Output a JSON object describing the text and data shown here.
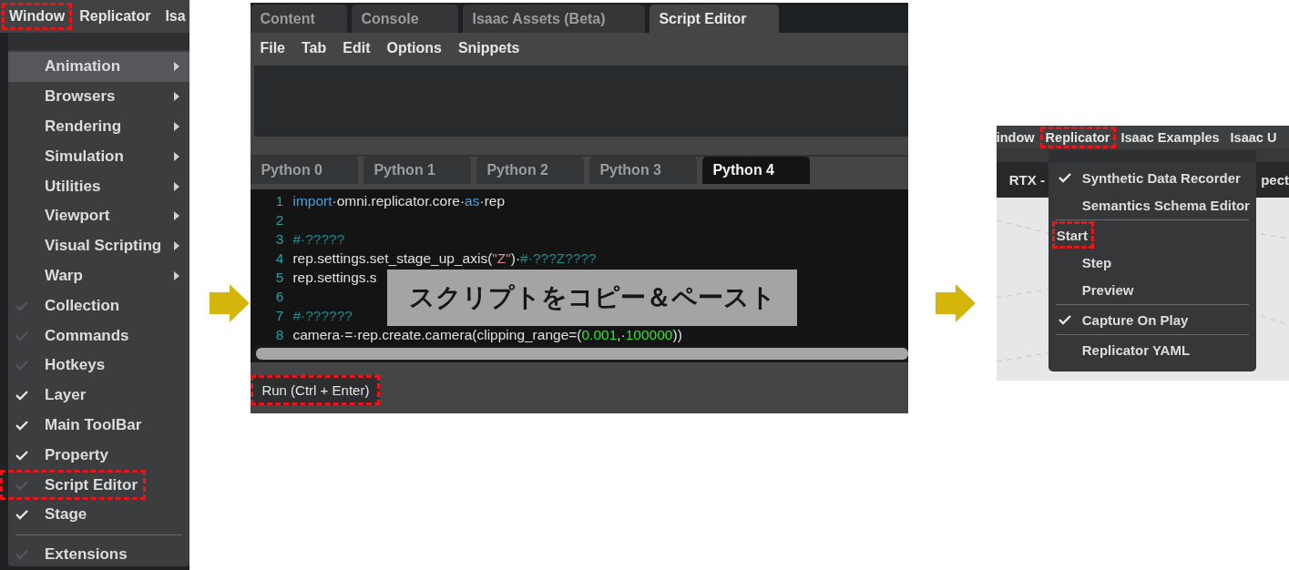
{
  "window_menu": {
    "menubar": [
      {
        "label": "Window",
        "highlighted": true
      },
      {
        "label": "Replicator",
        "highlighted": false
      },
      {
        "label": "Isa",
        "highlighted": false
      }
    ],
    "items": [
      {
        "kind": "submenu",
        "label": "Animation",
        "hovered": true,
        "highlighted": false
      },
      {
        "kind": "submenu",
        "label": "Browsers",
        "hovered": false,
        "highlighted": false
      },
      {
        "kind": "submenu",
        "label": "Rendering",
        "hovered": false,
        "highlighted": false
      },
      {
        "kind": "submenu",
        "label": "Simulation",
        "hovered": false,
        "highlighted": false
      },
      {
        "kind": "submenu",
        "label": "Utilities",
        "hovered": false,
        "highlighted": false
      },
      {
        "kind": "submenu",
        "label": "Viewport",
        "hovered": false,
        "highlighted": false
      },
      {
        "kind": "submenu",
        "label": "Visual Scripting",
        "hovered": false,
        "highlighted": false
      },
      {
        "kind": "submenu",
        "label": "Warp",
        "hovered": false,
        "highlighted": false
      },
      {
        "kind": "toggle",
        "label": "Collection",
        "checked": false,
        "highlighted": false
      },
      {
        "kind": "toggle",
        "label": "Commands",
        "checked": false,
        "highlighted": false
      },
      {
        "kind": "toggle",
        "label": "Hotkeys",
        "checked": false,
        "highlighted": false
      },
      {
        "kind": "toggle",
        "label": "Layer",
        "checked": true,
        "highlighted": false
      },
      {
        "kind": "toggle",
        "label": "Main ToolBar",
        "checked": true,
        "highlighted": false
      },
      {
        "kind": "toggle",
        "label": "Property",
        "checked": true,
        "highlighted": false
      },
      {
        "kind": "toggle",
        "label": "Script Editor",
        "checked": false,
        "highlighted": true
      },
      {
        "kind": "toggle",
        "label": "Stage",
        "checked": true,
        "highlighted": false
      },
      {
        "kind": "separator"
      },
      {
        "kind": "toggle",
        "label": "Extensions",
        "checked": false,
        "highlighted": false
      }
    ]
  },
  "script_editor": {
    "window_tabs": [
      {
        "label": "Content",
        "selected": false
      },
      {
        "label": "Console",
        "selected": false
      },
      {
        "label": "Isaac Assets (Beta)",
        "selected": false
      },
      {
        "label": "Script Editor",
        "selected": true
      }
    ],
    "menu": [
      "File",
      "Tab",
      "Edit",
      "Options",
      "Snippets"
    ],
    "file_tabs": [
      {
        "label": "Python 0",
        "selected": false
      },
      {
        "label": "Python 1",
        "selected": false
      },
      {
        "label": "Python 2",
        "selected": false
      },
      {
        "label": "Python 3",
        "selected": false
      },
      {
        "label": "Python 4",
        "selected": true
      }
    ],
    "code_lines": [
      {
        "number": "1",
        "tokens": [
          {
            "kind": "keyword",
            "text": "import"
          },
          {
            "kind": "plain",
            "text": "·omni.replicator.core·"
          },
          {
            "kind": "keyword",
            "text": "as"
          },
          {
            "kind": "plain",
            "text": "·rep"
          }
        ]
      },
      {
        "number": "2"
      },
      {
        "number": "3",
        "tokens": [
          {
            "kind": "comment",
            "text": "#·?????"
          }
        ]
      },
      {
        "number": "4",
        "tokens": [
          {
            "kind": "plain",
            "text": "rep.settings.set_stage_up_axis("
          },
          {
            "kind": "string",
            "text": "\"Z\""
          },
          {
            "kind": "plain",
            "text": ")·"
          },
          {
            "kind": "comment",
            "text": "#·???Z????"
          }
        ]
      },
      {
        "number": "5",
        "tokens": [
          {
            "kind": "plain",
            "text": "rep.settings.s"
          }
        ]
      },
      {
        "number": "6"
      },
      {
        "number": "7",
        "tokens": [
          {
            "kind": "comment",
            "text": "#·??????"
          }
        ]
      },
      {
        "number": "8",
        "tokens": [
          {
            "kind": "plain",
            "text": "camera·=·rep.create.camera(clipping_range=("
          },
          {
            "kind": "number",
            "text": "0.001"
          },
          {
            "kind": "plain",
            "text": ",·"
          },
          {
            "kind": "number",
            "text": "100000"
          },
          {
            "kind": "plain",
            "text": "))"
          }
        ]
      }
    ],
    "overlay_caption": "スクリプトをコピー＆ペースト",
    "run_button": {
      "label": "Run (Ctrl + Enter)",
      "highlighted": true
    }
  },
  "replicator_menu": {
    "menubar": [
      {
        "label": "indow",
        "highlighted": false
      },
      {
        "label": "Replicator",
        "highlighted": true
      },
      {
        "label": "Isaac Examples",
        "highlighted": false
      },
      {
        "label": "Isaac U",
        "highlighted": false
      }
    ],
    "toolbar": [
      "RTX -",
      "pect"
    ],
    "items": [
      {
        "kind": "toggle",
        "label": "Synthetic Data Recorder",
        "checked": true,
        "highlighted": false
      },
      {
        "kind": "toggle",
        "label": "Semantics Schema Editor",
        "checked": false,
        "highlighted": false
      },
      {
        "kind": "separator"
      },
      {
        "kind": "toggle",
        "label": "Start",
        "checked": false,
        "highlighted": true
      },
      {
        "kind": "toggle",
        "label": "Step",
        "checked": false,
        "highlighted": false
      },
      {
        "kind": "toggle",
        "label": "Preview",
        "checked": false,
        "highlighted": false
      },
      {
        "kind": "separator"
      },
      {
        "kind": "toggle",
        "label": "Capture On Play",
        "checked": true,
        "highlighted": false
      },
      {
        "kind": "separator"
      },
      {
        "kind": "toggle",
        "label": "Replicator YAML",
        "checked": false,
        "highlighted": false
      }
    ]
  }
}
